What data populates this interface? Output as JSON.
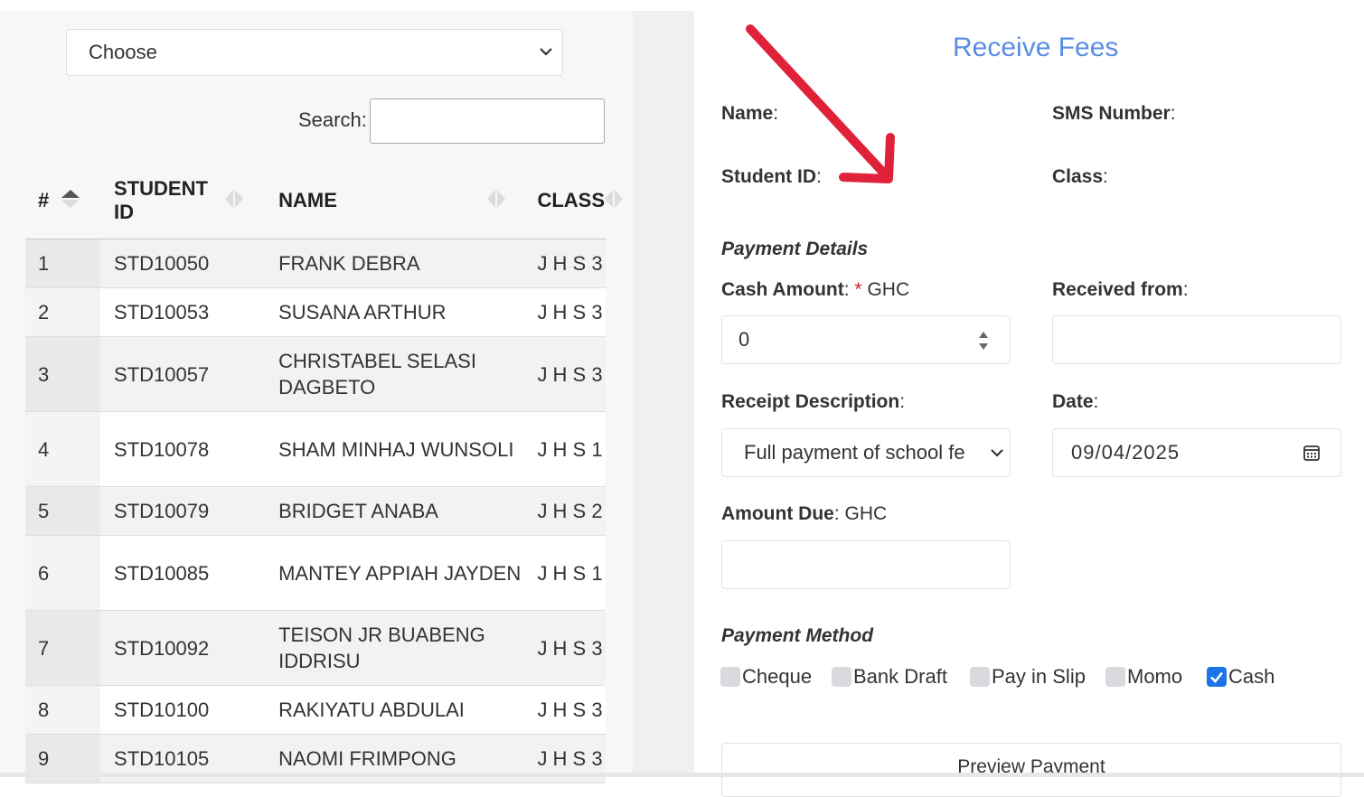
{
  "left_panel": {
    "select_value": "Choose",
    "search_label": "Search:",
    "search_value": "",
    "table": {
      "headers": [
        "#",
        "STUDENT ID",
        "NAME",
        "CLASS"
      ],
      "rows": [
        {
          "num": "1",
          "id": "STD10050",
          "name": "FRANK DEBRA",
          "cls": "J H S 3"
        },
        {
          "num": "2",
          "id": "STD10053",
          "name": "SUSANA ARTHUR",
          "cls": "J H S 3"
        },
        {
          "num": "3",
          "id": "STD10057",
          "name": "CHRISTABEL SELASI DAGBETO",
          "cls": "J H S 3"
        },
        {
          "num": "4",
          "id": "STD10078",
          "name": "SHAM MINHAJ WUNSOLI",
          "cls": "J H S 1"
        },
        {
          "num": "5",
          "id": "STD10079",
          "name": "BRIDGET ANABA",
          "cls": "J H S 2"
        },
        {
          "num": "6",
          "id": "STD10085",
          "name": "MANTEY APPIAH JAYDEN",
          "cls": "J H S 1"
        },
        {
          "num": "7",
          "id": "STD10092",
          "name": "TEISON JR BUABENG IDDRISU",
          "cls": "J H S 3"
        },
        {
          "num": "8",
          "id": "STD10100",
          "name": "RAKIYATU ABDULAI",
          "cls": "J H S 3"
        },
        {
          "num": "9",
          "id": "STD10105",
          "name": "NAOMI FRIMPONG",
          "cls": "J H S 3"
        }
      ]
    }
  },
  "form": {
    "title": "Receive Fees",
    "name_label": "Name",
    "sms_label": "SMS Number",
    "student_id_label": "Student ID",
    "class_label": "Class",
    "payment_details": "Payment Details",
    "cash_amount_label": "Cash Amount",
    "required_mark": "*",
    "currency": "GHC",
    "cash_amount_value": "0",
    "received_from_label": "Received from",
    "received_from_value": "",
    "receipt_description_label": "Receipt Description",
    "receipt_description_value": "Full payment of school fe",
    "date_label": "Date",
    "date_value": "09/04/2025",
    "amount_due_label": "Amount Due",
    "amount_due_value": "",
    "payment_method": "Payment Method",
    "methods": [
      {
        "label": "Cheque",
        "checked": false
      },
      {
        "label": "Bank Draft",
        "checked": false
      },
      {
        "label": "Pay in Slip",
        "checked": false
      },
      {
        "label": "Momo",
        "checked": false
      },
      {
        "label": "Cash",
        "checked": true
      }
    ],
    "preview_button": "Preview Payment"
  },
  "colors": {
    "title": "#5a8de2",
    "required": "#d42020",
    "checkbox_checked": "#1a73e8",
    "annotation_arrow": "#e0213a"
  },
  "icons": [
    "chevron-down-icon",
    "sort-icon",
    "spinner-icon",
    "calendar-icon",
    "check-icon",
    "annotation-arrow"
  ]
}
